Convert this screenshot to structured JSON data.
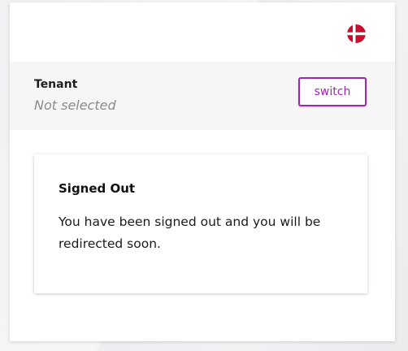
{
  "header": {
    "language_flag_icon": "denmark-flag-icon",
    "flag_colors": {
      "red": "#c8102e",
      "white": "#ffffff"
    }
  },
  "tenant": {
    "title": "Tenant",
    "value": "Not selected",
    "switch_label": "switch",
    "accent_color": "#9c27b0"
  },
  "message": {
    "title": "Signed Out",
    "body": "You have been signed out and you will be redirected soon."
  }
}
